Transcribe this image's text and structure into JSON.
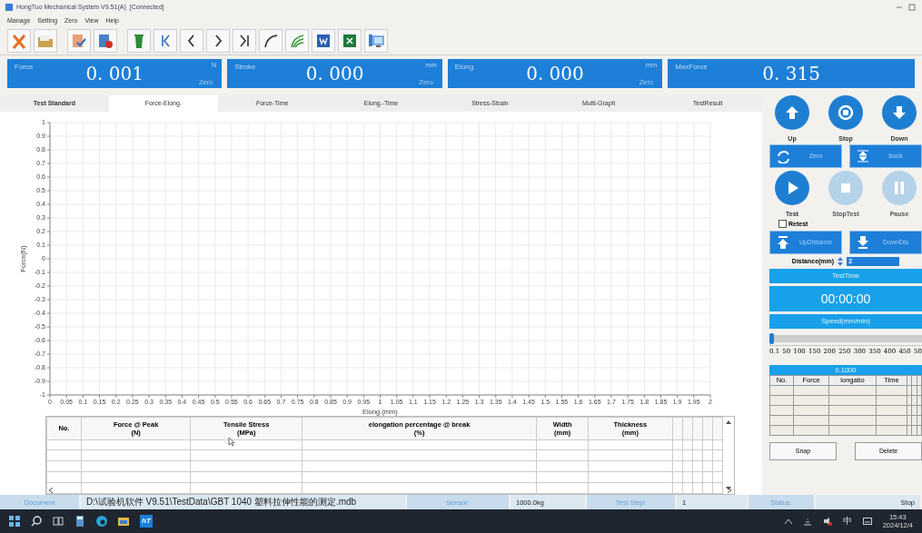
{
  "window": {
    "title": "HongTuo Mechanical System V9.51(A)",
    "connection": "[Connected]"
  },
  "menu": [
    "Manage",
    "Setting",
    "Zero",
    "View",
    "Help"
  ],
  "readouts": [
    {
      "label": "Force",
      "value": "0. 001",
      "unit": "N",
      "zero": "Zero"
    },
    {
      "label": "Stroke",
      "value": "0. 000",
      "unit": "mm",
      "zero": "Zero"
    },
    {
      "label": "Elong.",
      "value": "0. 000",
      "unit": "mm",
      "zero": "Zero"
    },
    {
      "label": "MaxForce",
      "value": "0. 315"
    }
  ],
  "tabs": [
    {
      "label": "Test Standard",
      "selected": false
    },
    {
      "label": "Force-Elong.",
      "selected": true
    },
    {
      "label": "Force-Time",
      "selected": false
    },
    {
      "label": "Elong.-Time",
      "selected": false
    },
    {
      "label": "Stress-Strain",
      "selected": false
    },
    {
      "label": "Multi-Graph",
      "selected": false
    },
    {
      "label": "TestResult",
      "selected": false
    }
  ],
  "chart_data": {
    "type": "line",
    "grid": true,
    "xlabel": "Elong.(mm)",
    "ylabel": "Force(N)",
    "xlim": [
      0,
      2
    ],
    "ylim": [
      -1,
      1
    ],
    "xticks": [
      0,
      0.05,
      0.1,
      0.15,
      0.2,
      0.25,
      0.3,
      0.35,
      0.4,
      0.45,
      0.5,
      0.55,
      0.6,
      0.65,
      0.7,
      0.75,
      0.8,
      0.85,
      0.9,
      0.95,
      1,
      1.05,
      1.1,
      1.15,
      1.2,
      1.25,
      1.3,
      1.35,
      1.4,
      1.45,
      1.5,
      1.55,
      1.6,
      1.65,
      1.7,
      1.75,
      1.8,
      1.85,
      1.9,
      1.95,
      2
    ],
    "yticks": [
      1,
      0.9,
      0.8,
      0.7,
      0.6,
      0.5,
      0.4,
      0.3,
      0.2,
      0.1,
      0,
      -0.1,
      -0.2,
      -0.3,
      -0.4,
      -0.5,
      -0.6,
      -0.7,
      -0.8,
      -0.9,
      -1
    ]
  },
  "results": {
    "columns": [
      "No.",
      "Force @ Peak\n(N)",
      "Tensile Stress\n(MPa)",
      "elongation percentage @ break\n(%)",
      "Width\n(mm)",
      "Thickness\n(mm)"
    ]
  },
  "jog": [
    {
      "label": "Up",
      "kind": "up"
    },
    {
      "label": "Stop",
      "kind": "stop"
    },
    {
      "label": "Down",
      "kind": "down"
    }
  ],
  "zero_back": [
    {
      "label": "Zero",
      "kind": "zero"
    },
    {
      "label": "Back",
      "kind": "back"
    }
  ],
  "test": [
    {
      "label": "Test",
      "kind": "play",
      "disabled": false
    },
    {
      "label": "StopTest",
      "kind": "stop",
      "disabled": true
    },
    {
      "label": "Pause",
      "kind": "pause",
      "disabled": true
    }
  ],
  "retest": {
    "label": "Retest",
    "checked": false
  },
  "distance_buttons": [
    {
      "label": "UpDistance",
      "kind": "up"
    },
    {
      "label": "DownDis",
      "kind": "down"
    }
  ],
  "distance": {
    "label": "Distance(mm)",
    "value": "2"
  },
  "test_time": {
    "label": "TestTime",
    "value": "00:00:00"
  },
  "speed": {
    "label": "Speed(mm/min)",
    "level": 0,
    "scale": [
      "0.1",
      "50",
      "100",
      "150",
      "200",
      "250",
      "300",
      "350",
      "400",
      "450",
      "50"
    ]
  },
  "points": {
    "title": "0.1000",
    "columns": [
      "No.",
      "Force",
      "longatio",
      "Time"
    ]
  },
  "buttons": [
    "Snap",
    "Delete"
  ],
  "status_bar": [
    {
      "text": "Document",
      "kind": "label"
    },
    {
      "text": "D:\\试验机软件 V9.51\\TestData\\GBT 1040 塑料拉伸性能的测定.mdb",
      "kind": "value"
    },
    {
      "text": "Sensor:",
      "kind": "label"
    },
    {
      "text": "1000.0kg",
      "kind": "value"
    },
    {
      "text": "Test Step:",
      "kind": "label"
    },
    {
      "text": "1",
      "kind": "value"
    },
    {
      "text": "Status:",
      "kind": "label"
    },
    {
      "text": "Stop",
      "kind": "value"
    }
  ],
  "taskbar": {
    "app_label": "hT",
    "ime": "中",
    "time": "15:43",
    "date": "2024/12/4"
  }
}
